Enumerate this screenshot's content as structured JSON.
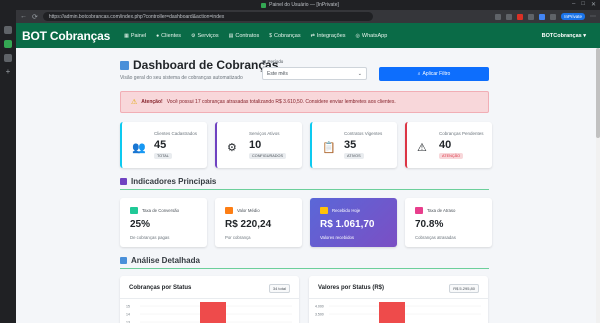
{
  "window": {
    "title": "Painel do Usuário — [InPrivate]"
  },
  "browser": {
    "url": "https://admin.botcobrancas.com/index.php?controller=dashboard&action=index",
    "inprivate": "InPrivate"
  },
  "app": {
    "brand": "BOT Cobranças",
    "nav": [
      "Painel",
      "Clientes",
      "Serviços",
      "Contratos",
      "Cobranças",
      "Integrações",
      "WhatsApp"
    ],
    "user": "BOTCobranças ▾"
  },
  "page": {
    "title": "Dashboard de Cobranças",
    "subtitle": "Visão geral do seu sistema de cobranças automatizado"
  },
  "filter": {
    "label": "Período",
    "value": "Este mês",
    "apply": "Aplicar Filtro"
  },
  "alert": {
    "strong": "Atenção!",
    "text": "Você possui 17 cobranças atrasadas totalizando R$ 3.610,50. Considere enviar lembretes aos clientes."
  },
  "stats": [
    {
      "label": "Clientes Cadastrados",
      "value": "45",
      "badge": "TOTAL",
      "color": "#0dcaf0",
      "icon": "users-icon",
      "glyph": "👥"
    },
    {
      "label": "Serviços Ativos",
      "value": "10",
      "badge": "CONFIGURADOS",
      "color": "#6f42c1",
      "icon": "gear-icon",
      "glyph": "⚙"
    },
    {
      "label": "Contratos Vigentes",
      "value": "35",
      "badge": "ATIVOS",
      "color": "#0dcaf0",
      "icon": "clipboard-icon",
      "glyph": "📋"
    },
    {
      "label": "Cobranças Pendentes",
      "value": "40",
      "badge": "ATENÇÃO",
      "color": "#dc3545",
      "icon": "warning-icon",
      "glyph": "⚠"
    }
  ],
  "sections": {
    "kpis": "Indicadores Principais",
    "analysis": "Análise Detalhada"
  },
  "kpis": [
    {
      "label": "Taxa de Conversão",
      "value": "25%",
      "sub": "De cobranças pagas",
      "icon": "check-icon",
      "color": "#20c997"
    },
    {
      "label": "Valor Médio",
      "value": "R$ 220,24",
      "sub": "Por cobrança",
      "icon": "coin-icon",
      "color": "#fd7e14"
    },
    {
      "label": "Recebido Hoje",
      "value": "R$ 1.061,70",
      "sub": "Valores recebidos",
      "icon": "money-icon",
      "color": "#ffc107"
    },
    {
      "label": "Taxa de Atraso",
      "value": "70.8%",
      "sub": "Cobranças atrasadas",
      "icon": "clock-icon",
      "color": "#e83e8c"
    }
  ],
  "charts": [
    {
      "title": "Cobranças por Status",
      "badge": "34 total"
    },
    {
      "title": "Valores por Status (R$)",
      "badge": "R$ 5.295,80"
    }
  ],
  "chart_data": [
    {
      "type": "bar",
      "title": "Cobranças por Status",
      "yticks": [
        "15",
        "14",
        "13"
      ],
      "ylim": [
        13,
        15
      ],
      "bar_color": "#ee4b4b"
    },
    {
      "type": "bar",
      "title": "Valores por Status (R$)",
      "yticks": [
        "4.000",
        "3.500"
      ],
      "ylim": [
        3500,
        4000
      ],
      "bar_color": "#ee4b4b"
    }
  ]
}
